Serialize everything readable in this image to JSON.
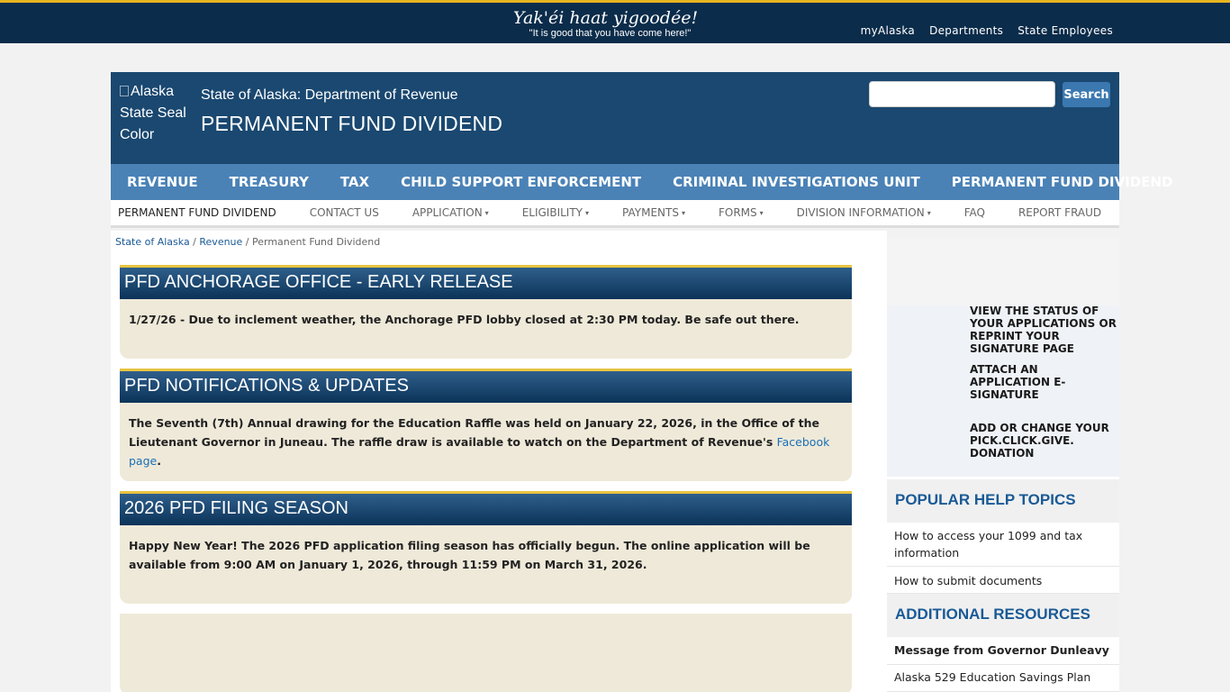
{
  "banner": {
    "welcome": "Yak'éi haat yigoodée!",
    "tagline": "\"It is good that you have come here!\"",
    "links": [
      "myAlaska",
      "Departments",
      "State Employees"
    ]
  },
  "header": {
    "seal_alt": "Alaska State Seal Color",
    "department": "State of Alaska: Department of Revenue",
    "division": "PERMANENT FUND DIVIDEND",
    "search_placeholder": "",
    "search_label": "Search"
  },
  "main_nav": [
    "REVENUE",
    "TREASURY",
    "TAX",
    "CHILD SUPPORT ENFORCEMENT",
    "CRIMINAL INVESTIGATIONS UNIT",
    "PERMANENT FUND DIVIDEND"
  ],
  "sub_nav": {
    "active": "PERMANENT FUND DIVIDEND",
    "contact": "CONTACT US",
    "application": "APPLICATION",
    "eligibility": "ELIGIBILITY",
    "payments": "PAYMENTS",
    "forms": "FORMS",
    "division_info": "DIVISION INFORMATION",
    "faq": "FAQ",
    "report_fraud": "REPORT FRAUD",
    "caret": "▾"
  },
  "breadcrumb": {
    "state": "State of Alaska",
    "sep": " / ",
    "revenue": "Revenue",
    "current": "Permanent Fund Dividend"
  },
  "cards": {
    "c1": {
      "title": "PFD ANCHORAGE OFFICE - EARLY RELEASE",
      "body": "1/27/26 - Due to inclement weather, the Anchorage PFD lobby closed at 2:30 PM today.  Be safe out there."
    },
    "c2": {
      "title": "PFD NOTIFICATIONS & UPDATES",
      "body": "The Seventh (7th) Annual drawing for the Education Raffle was held on January 22, 2026, in the Office of the Lieutenant Governor in Juneau.  The raffle draw is available to watch on the Department of Revenue's ",
      "link": "Facebook page",
      "after": "."
    },
    "c3": {
      "title": "2026 PFD FILING SEASON",
      "body": "Happy New Year!  The 2026 PFD application filing season has officially begun.  The online application will be available from 9:00 AM on January 1, 2026, through 11:59 PM on March 31, 2026."
    }
  },
  "sidebar": {
    "quick_links": [
      "VIEW THE STATUS OF YOUR APPLICATIONS OR REPRINT YOUR SIGNATURE PAGE",
      "ATTACH AN APPLICATION E-SIGNATURE",
      "ADD OR CHANGE YOUR PICK.CLICK.GIVE. DONATION"
    ],
    "popular_title": "POPULAR HELP TOPICS",
    "popular": [
      "How to access your 1099 and tax information",
      "How to submit documents"
    ],
    "resources_title": "ADDITIONAL RESOURCES",
    "resources": [
      "Message from Governor Dunleavy",
      "Alaska 529 Education Savings Plan"
    ]
  }
}
